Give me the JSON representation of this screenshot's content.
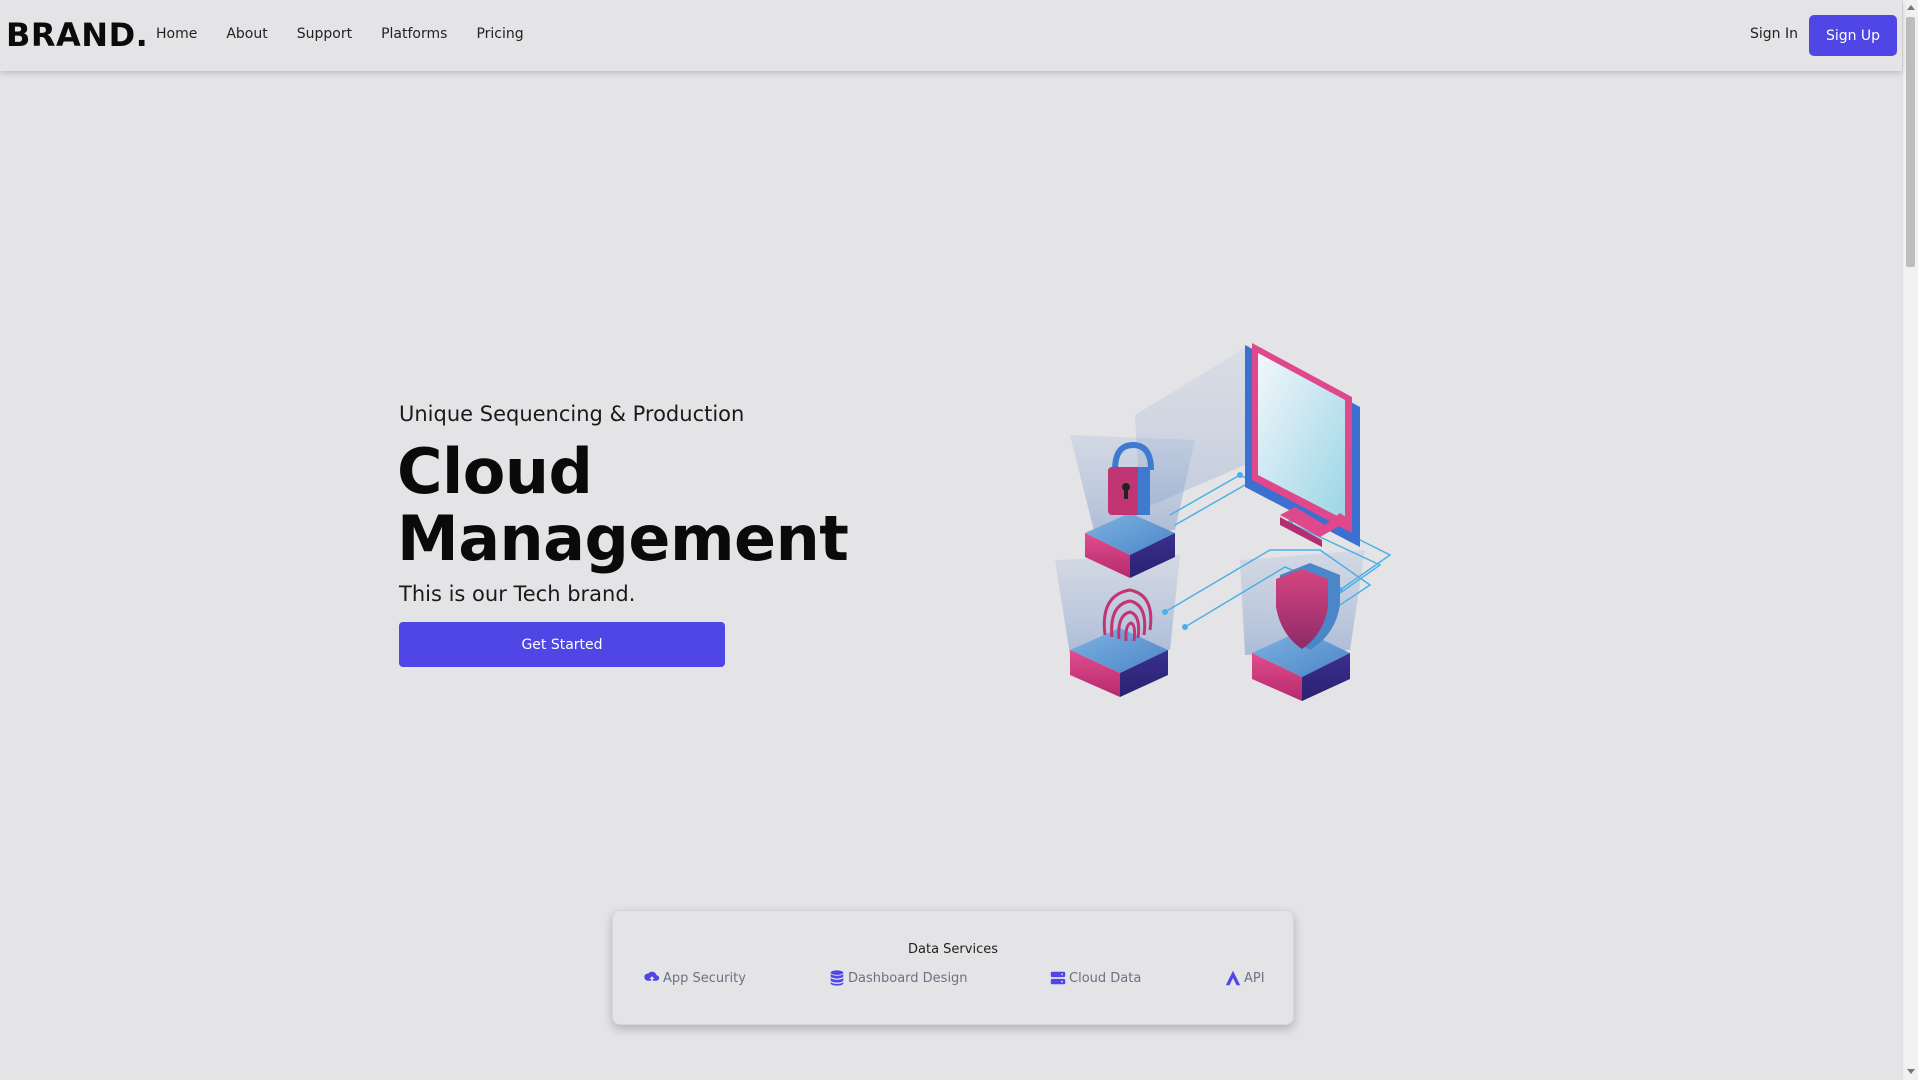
{
  "navbar": {
    "brand": "BRAND.",
    "links": [
      "Home",
      "About",
      "Support",
      "Platforms",
      "Pricing"
    ],
    "sign_in": "Sign In",
    "sign_up": "Sign Up"
  },
  "hero": {
    "kicker": "Unique Sequencing & Production",
    "title_line1": "Cloud",
    "title_line2": "Management",
    "tagline": "This is our Tech brand.",
    "cta_label": "Get Started"
  },
  "services": {
    "heading": "Data Services",
    "items": [
      {
        "label": "App Security",
        "icon": "cloud-upload-icon"
      },
      {
        "label": "Dashboard Design",
        "icon": "database-icon"
      },
      {
        "label": "Cloud Data",
        "icon": "server-icon"
      },
      {
        "label": "API",
        "icon": "api-icon"
      }
    ]
  },
  "colors": {
    "accent": "#4f46e5",
    "background": "#e4e4e7",
    "pink": "#d63a7e",
    "blue": "#3b82c4"
  }
}
